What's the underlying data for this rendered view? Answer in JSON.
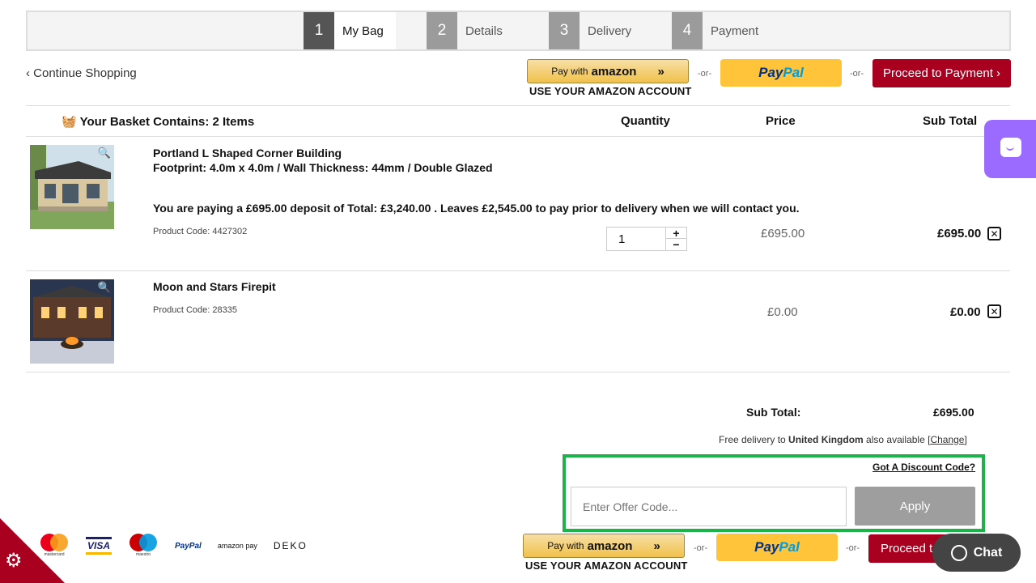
{
  "steps": [
    {
      "num": "1",
      "label": "My Bag"
    },
    {
      "num": "2",
      "label": "Details"
    },
    {
      "num": "3",
      "label": "Delivery"
    },
    {
      "num": "4",
      "label": "Payment"
    }
  ],
  "nav": {
    "continue_shopping": "‹ Continue Shopping"
  },
  "checkout": {
    "amazon_pay_prefix": "Pay with",
    "amazon_brand": "amazon",
    "amazon_chevron": "»",
    "amazon_sub": "USE YOUR AMAZON ACCOUNT",
    "or": "-or-",
    "paypal_a": "Pay",
    "paypal_b": "Pal",
    "proceed": "Proceed to Payment ›"
  },
  "basket": {
    "heading": "Your Basket Contains: 2 Items",
    "col_quantity": "Quantity",
    "col_price": "Price",
    "col_subtotal": "Sub Total",
    "items": [
      {
        "title": "Portland L Shaped Corner Building",
        "subtitle": "Footprint: 4.0m x 4.0m / Wall Thickness: 44mm / Double Glazed",
        "deposit_note": "You are paying a £695.00 deposit of Total: £3,240.00 . Leaves £2,545.00 to pay prior to delivery when we will contact you.",
        "product_code": "Product Code: 4427302",
        "quantity": "1",
        "price": "£695.00",
        "subtotal": "£695.00"
      },
      {
        "title": "Moon and Stars Firepit",
        "product_code": "Product Code: 28335",
        "price": "£0.00",
        "subtotal": "£0.00"
      }
    ]
  },
  "totals": {
    "label": "Sub Total:",
    "value": "£695.00",
    "delivery_prefix": "Free delivery to",
    "delivery_country": "United Kingdom",
    "delivery_suffix": "also available [",
    "change": "Change",
    "close_bracket": "]"
  },
  "discount": {
    "link": "Got A Discount Code?",
    "placeholder": "Enter Offer Code...",
    "apply": "Apply"
  },
  "chat": {
    "label": "Chat"
  },
  "payment_logos": {
    "mastercard": "mastercard",
    "visa": "VISA",
    "maestro": "maestro",
    "paypal": "PayPal",
    "amazonpay": "amazon pay",
    "deko": "DEKO"
  },
  "colors": {
    "accent": "#a8001e",
    "highlight": "#1db34a",
    "chat_widget": "#9b6bff"
  },
  "icons": {
    "basket": "basket-icon",
    "zoom": "magnifier-icon",
    "remove": "close-box-icon",
    "settings": "gear-icon"
  }
}
